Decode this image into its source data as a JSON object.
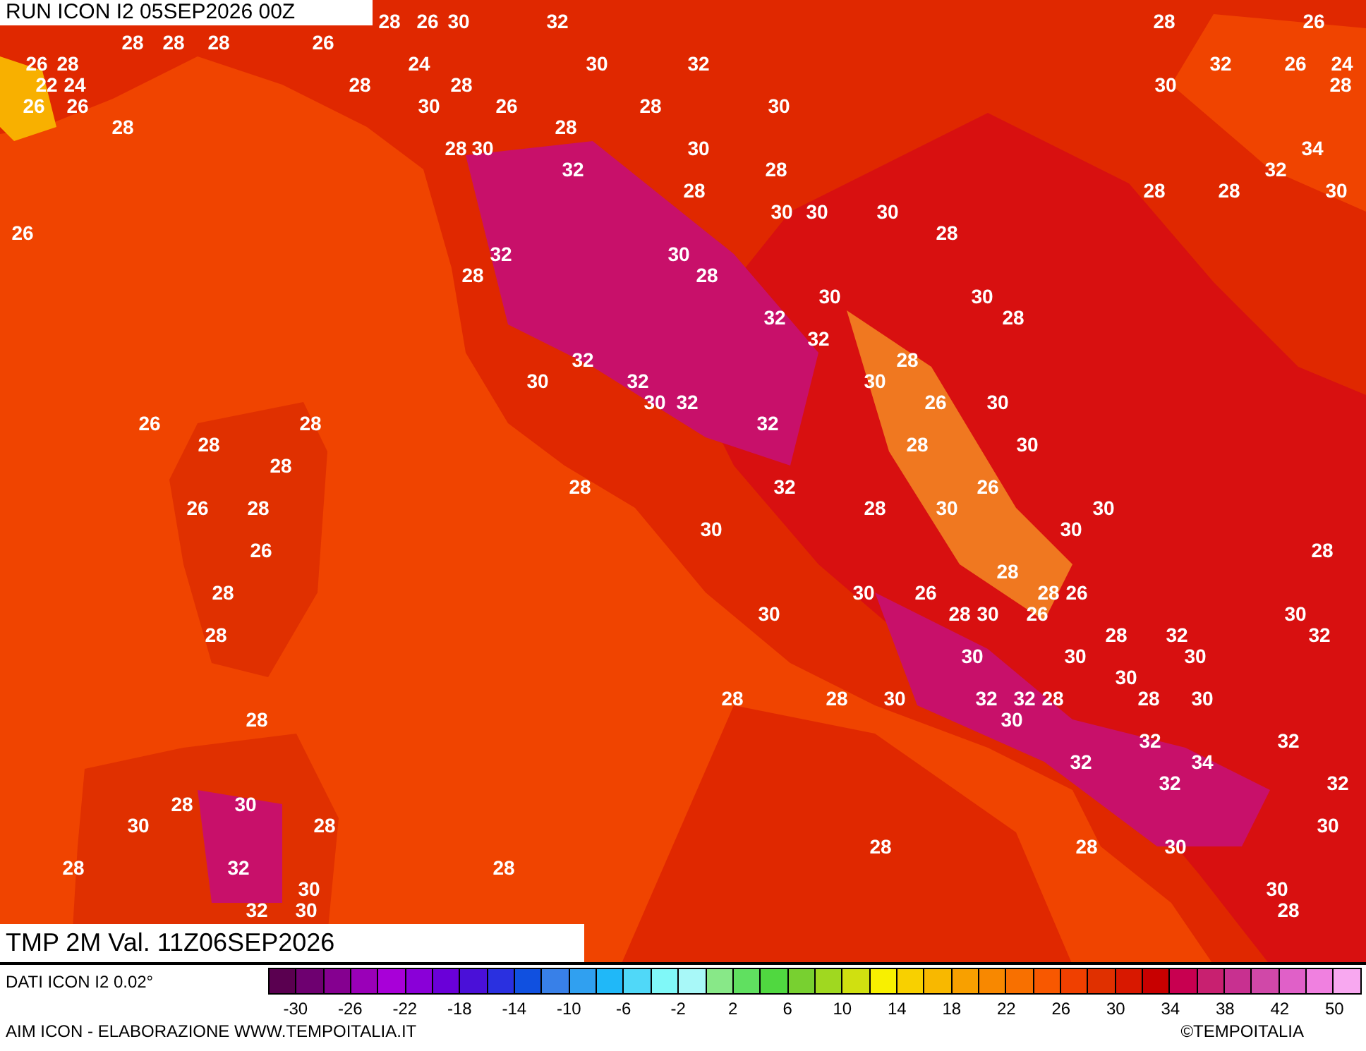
{
  "run_title": "RUN ICON I2 05SEP2026 00Z",
  "map": {
    "labels": [
      "28",
      "26",
      "30",
      "32",
      "28",
      "26",
      "28",
      "28",
      "28",
      "26",
      "26",
      "28",
      "24",
      "30",
      "32",
      "32",
      "26",
      "24",
      "22",
      "24",
      "28",
      "28",
      "30",
      "28",
      "26",
      "26",
      "30",
      "26",
      "28",
      "30",
      "28",
      "28",
      "28",
      "30",
      "30",
      "34",
      "32",
      "28",
      "32",
      "28",
      "28",
      "28",
      "30",
      "30",
      "30",
      "30",
      "26",
      "28",
      "32",
      "30",
      "28",
      "28",
      "30",
      "30",
      "32",
      "28",
      "32",
      "32",
      "28",
      "30",
      "32",
      "30",
      "30",
      "32",
      "26",
      "30",
      "26",
      "28",
      "32",
      "28",
      "28",
      "30",
      "28",
      "28",
      "32",
      "26",
      "26",
      "28",
      "28",
      "30",
      "30",
      "30",
      "30",
      "26",
      "28",
      "28",
      "28",
      "30",
      "26",
      "28",
      "26",
      "30",
      "28",
      "30",
      "26",
      "30",
      "28",
      "28",
      "32",
      "32",
      "30",
      "30",
      "30",
      "30",
      "28",
      "28",
      "30",
      "32",
      "32",
      "28",
      "28",
      "30",
      "28",
      "30",
      "32",
      "32",
      "32",
      "34",
      "32",
      "32",
      "28",
      "30",
      "30",
      "28",
      "30",
      "28",
      "28",
      "30",
      "28",
      "32",
      "28",
      "30",
      "30",
      "32",
      "30",
      "28"
    ]
  },
  "valid_title": "TMP 2M Val. 11Z06SEP2026",
  "legend": {
    "caption": "DATI ICON I2 0.02°",
    "colors": [
      {
        "color": "#5a0050"
      },
      {
        "color": "#6e0070"
      },
      {
        "color": "#850090"
      },
      {
        "color": "#9a00b8"
      },
      {
        "color": "#a800d8"
      },
      {
        "color": "#8a00d8"
      },
      {
        "color": "#6a00d8"
      },
      {
        "color": "#4a10d8"
      },
      {
        "color": "#2a30e0"
      },
      {
        "color": "#1050e0"
      },
      {
        "color": "#3880e8"
      },
      {
        "color": "#30a0f0"
      },
      {
        "color": "#20b8f8"
      },
      {
        "color": "#50d8f8"
      },
      {
        "color": "#80f8f8"
      },
      {
        "color": "#a8f8f8"
      },
      {
        "color": "#88e888"
      },
      {
        "color": "#60e060"
      },
      {
        "color": "#50d840"
      },
      {
        "color": "#78d030"
      },
      {
        "color": "#a0d820"
      },
      {
        "color": "#d0e010"
      },
      {
        "color": "#f8f000"
      },
      {
        "color": "#f8d000"
      },
      {
        "color": "#f8b800"
      },
      {
        "color": "#f8a000"
      },
      {
        "color": "#f88800"
      },
      {
        "color": "#f87000"
      },
      {
        "color": "#f85800"
      },
      {
        "color": "#f04000"
      },
      {
        "color": "#e03000"
      },
      {
        "color": "#d81800"
      },
      {
        "color": "#c80000"
      },
      {
        "color": "#c80050"
      },
      {
        "color": "#c82070"
      },
      {
        "color": "#c83090"
      },
      {
        "color": "#d048a8"
      },
      {
        "color": "#e060c8"
      },
      {
        "color": "#f080e0"
      },
      {
        "color": "#f8a8f0"
      }
    ],
    "ticks": [
      "-30",
      "-26",
      "-22",
      "-18",
      "-14",
      "-10",
      "-6",
      "-2",
      "2",
      "6",
      "10",
      "14",
      "18",
      "22",
      "26",
      "30",
      "34",
      "38",
      "42",
      "50"
    ]
  },
  "credit": "AIM ICON - ELABORAZIONE WWW.TEMPOITALIA.IT",
  "copyright": "©TEMPOITALIA"
}
